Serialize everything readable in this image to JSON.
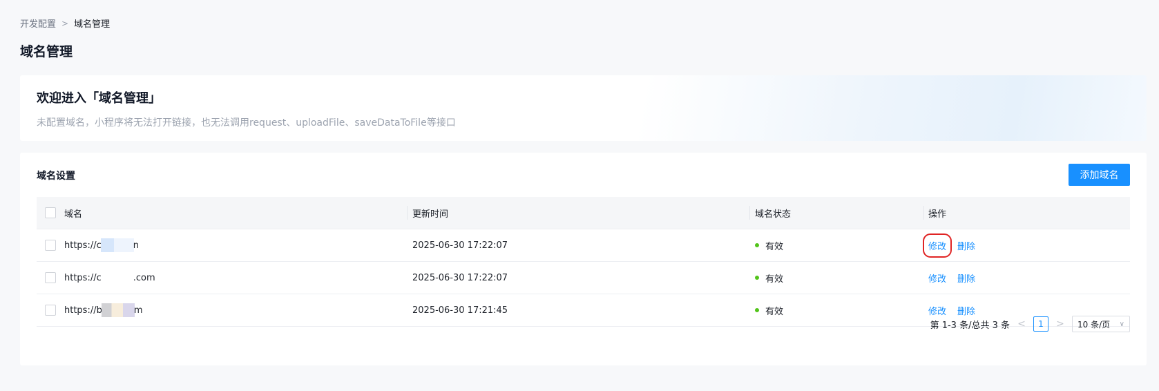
{
  "breadcrumb": {
    "parent": "开发配置",
    "separator": ">",
    "current": "域名管理"
  },
  "page_title": "域名管理",
  "welcome": {
    "title": "欢迎进入「域名管理」",
    "description": "未配置域名，小程序将无法打开链接，也无法调用request、uploadFile、saveDataToFile等接口"
  },
  "domain_settings": {
    "title": "域名设置",
    "add_button": "添加域名"
  },
  "table": {
    "headers": {
      "domain": "域名",
      "updated": "更新时间",
      "status": "域名状态",
      "ops": "操作"
    },
    "rows": [
      {
        "domain_prefix": "https://c",
        "domain_suffix": "n",
        "updated": "2025-06-30 17:22:07",
        "status": "有效",
        "edit": "修改",
        "delete": "删除"
      },
      {
        "domain_prefix": "https://c",
        "domain_suffix": ".com",
        "updated": "2025-06-30 17:22:07",
        "status": "有效",
        "edit": "修改",
        "delete": "删除"
      },
      {
        "domain_prefix": "https://b",
        "domain_suffix": "m",
        "updated": "2025-06-30 17:21:45",
        "status": "有效",
        "edit": "修改",
        "delete": "删除"
      }
    ]
  },
  "pagination": {
    "summary": "第 1-3 条/总共 3 条",
    "prev": "<",
    "current_page": "1",
    "next": ">",
    "page_size": "10 条/页"
  },
  "colors": {
    "accent": "#1890ff",
    "status_valid": "#52c41a",
    "highlight": "#e02424"
  }
}
